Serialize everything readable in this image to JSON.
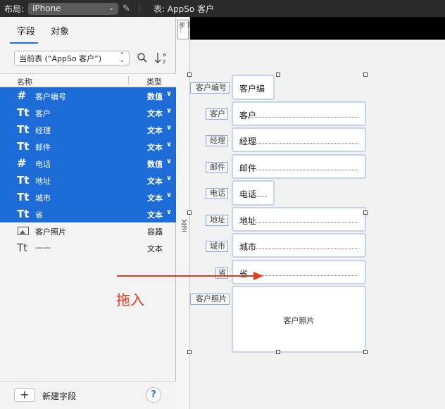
{
  "toolbar": {
    "layout_label": "布局:",
    "layout_value": "iPhone",
    "table_title": "表: AppSo 客户"
  },
  "panel": {
    "tabs": [
      {
        "label": "字段",
        "active": true
      },
      {
        "label": "对象",
        "active": false
      }
    ],
    "table_select": "当前表 (“AppSo 客户”)",
    "columns": {
      "name": "名称",
      "type": "类型"
    },
    "fields": [
      {
        "icon": "#",
        "name": "客户编号",
        "type": "数值",
        "selected": true
      },
      {
        "icon": "Tt",
        "name": "客户",
        "type": "文本",
        "selected": true
      },
      {
        "icon": "Tt",
        "name": "经理",
        "type": "文本",
        "selected": true
      },
      {
        "icon": "Tt",
        "name": "邮件",
        "type": "文本",
        "selected": true
      },
      {
        "icon": "#",
        "name": "电话",
        "type": "数值",
        "selected": true
      },
      {
        "icon": "Tt",
        "name": "地址",
        "type": "文本",
        "selected": true
      },
      {
        "icon": "Tt",
        "name": "城市",
        "type": "文本",
        "selected": true
      },
      {
        "icon": "Tt",
        "name": "省",
        "type": "文本",
        "selected": true
      },
      {
        "icon": "image",
        "name": "客户照片",
        "type": "容器",
        "selected": false
      },
      {
        "icon": "Tt",
        "name": "——",
        "type": "文本",
        "selected": false
      }
    ],
    "add_field_label": "新建字段",
    "help_label": "?"
  },
  "canvas": {
    "part_top_label": "顶部…",
    "part_body_label": "正文",
    "labels": [
      "客户编号",
      "客户",
      "经理",
      "邮件",
      "电话",
      "地址",
      "城市",
      "省",
      "客户照片"
    ],
    "fields": [
      "客户编",
      "客户",
      "经理",
      "邮件",
      "电话",
      "地址",
      "城市",
      "省",
      "客户照片"
    ]
  },
  "annotation": {
    "drag_label": "拖入",
    "color": "#e23b1f"
  },
  "colors": {
    "selection": "#1d6bd7",
    "accent": "#1f73e6"
  }
}
